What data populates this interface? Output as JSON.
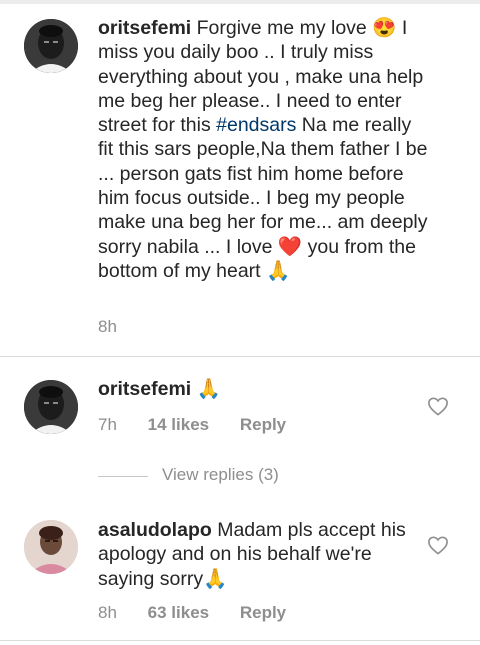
{
  "comments": [
    {
      "username": "oritsefemi",
      "text_before_hashtag": "Forgive me my love 😍 I miss you daily boo .. I truly miss everything about you , make una help me beg her please.. I need to enter street for this ",
      "hashtag": "#endsars",
      "text_after_hashtag": " Na me really fit this sars people,Na them father I be ... person gats fist him home before him focus outside.. I beg my people make una beg her for me... am deeply sorry nabila ... I love ❤️ you from the bottom of my heart 🙏",
      "time": "8h",
      "avatar_icon": "profile-photo-man"
    },
    {
      "username": "oritsefemi",
      "text": "🙏",
      "time": "7h",
      "likes": "14 likes",
      "reply_label": "Reply",
      "avatar_icon": "profile-photo-man",
      "liked": false
    },
    {
      "username": "asaludolapo",
      "text": "Madam pls accept his apology and on his behalf we're saying sorry🙏",
      "time": "8h",
      "likes": "63 likes",
      "reply_label": "Reply",
      "avatar_icon": "profile-photo-woman",
      "liked": false
    }
  ],
  "view_replies_label": "View replies (3)",
  "colors": {
    "text": "#262626",
    "secondary": "#8e8e8e",
    "hashtag": "#00376b",
    "divider": "#dbdbdb"
  }
}
